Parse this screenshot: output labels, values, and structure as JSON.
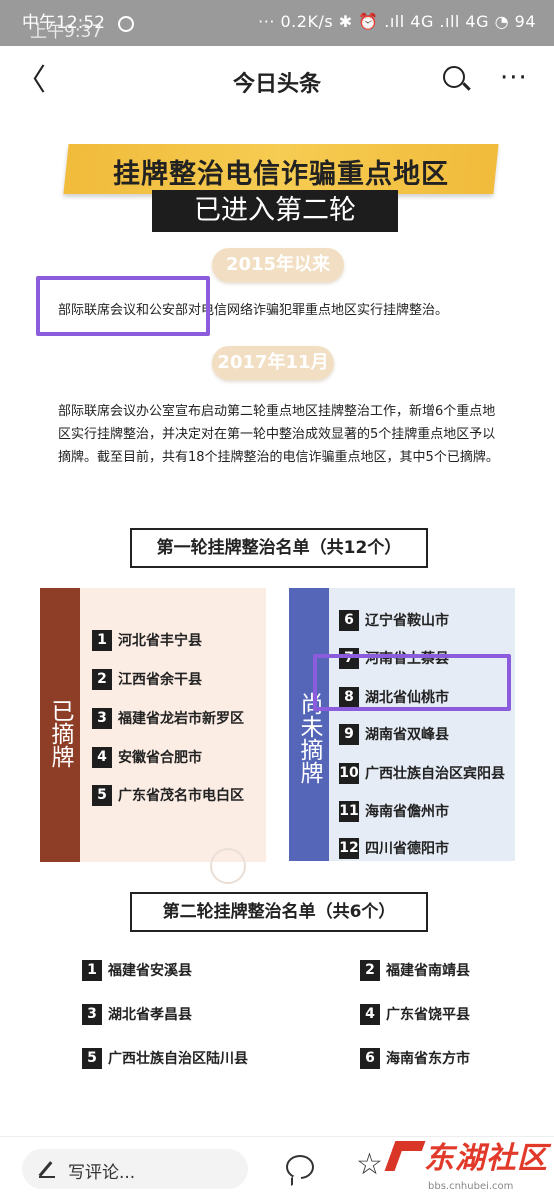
{
  "status_bar": {
    "time_ghost": "中午12:52",
    "time": "上午9:37",
    "right": "··· 0.2K/s ✱ ⏰ .ıll 4G .ıll 4G ◔ 94"
  },
  "nav": {
    "back_glyph": "〈",
    "title": "今日头条",
    "more_glyph": "···"
  },
  "article": {
    "banner_title": "挂牌整治电信诈骗重点地区",
    "banner_subtitle": "已进入第二轮",
    "pill_2015": "2015年以来",
    "text_2015": "部际联席会议和公安部对电信网络诈骗犯罪重点地区实行挂牌整治。",
    "pill_2017": "2017年11月",
    "text_2017": "部际联席会议办公室宣布启动第二轮重点地区挂牌整治工作，新增6个重点地区实行挂牌整治，并决定对在第一轮中整治成效显著的5个挂牌重点地区予以摘牌。截至目前，共有18个挂牌整治的电信诈骗重点地区，其中5个已摘牌。",
    "round1_title": "第一轮挂牌整治名单（共12个）",
    "removed_label": "已摘牌",
    "not_removed_label": "尚未摘牌",
    "round1_removed": [
      {
        "num": "1",
        "name": "河北省丰宁县"
      },
      {
        "num": "2",
        "name": "江西省余干县"
      },
      {
        "num": "3",
        "name": "福建省龙岩市新罗区"
      },
      {
        "num": "4",
        "name": "安徽省合肥市"
      },
      {
        "num": "5",
        "name": "广东省茂名市电白区"
      }
    ],
    "round1_remaining": [
      {
        "num": "6",
        "name": "辽宁省鞍山市"
      },
      {
        "num": "7",
        "name": "河南省上蔡县"
      },
      {
        "num": "8",
        "name": "湖北省仙桃市"
      },
      {
        "num": "9",
        "name": "湖南省双峰县"
      },
      {
        "num": "10",
        "name": "广西壮族自治区宾阳县"
      },
      {
        "num": "11",
        "name": "海南省儋州市"
      },
      {
        "num": "12",
        "name": "四川省德阳市"
      }
    ],
    "round2_title": "第二轮挂牌整治名单（共6个）",
    "round2": [
      {
        "num": "1",
        "name": "福建省安溪县"
      },
      {
        "num": "2",
        "name": "福建省南靖县"
      },
      {
        "num": "3",
        "name": "湖北省孝昌县"
      },
      {
        "num": "4",
        "name": "广东省饶平县"
      },
      {
        "num": "5",
        "name": "广西壮族自治区陆川县"
      },
      {
        "num": "6",
        "name": "海南省东方市"
      }
    ]
  },
  "bottom_bar": {
    "comment_placeholder": "写评论...",
    "logo_text": "东湖社区",
    "logo_url_text": "bbs.cnhubei.com"
  },
  "colors": {
    "banner_gold": "#f1bb3b",
    "highlight_purple": "#8b5ddc",
    "removed_strip": "#8e3e26",
    "remaining_strip": "#5566b8",
    "logo_red": "#e23a2a"
  }
}
